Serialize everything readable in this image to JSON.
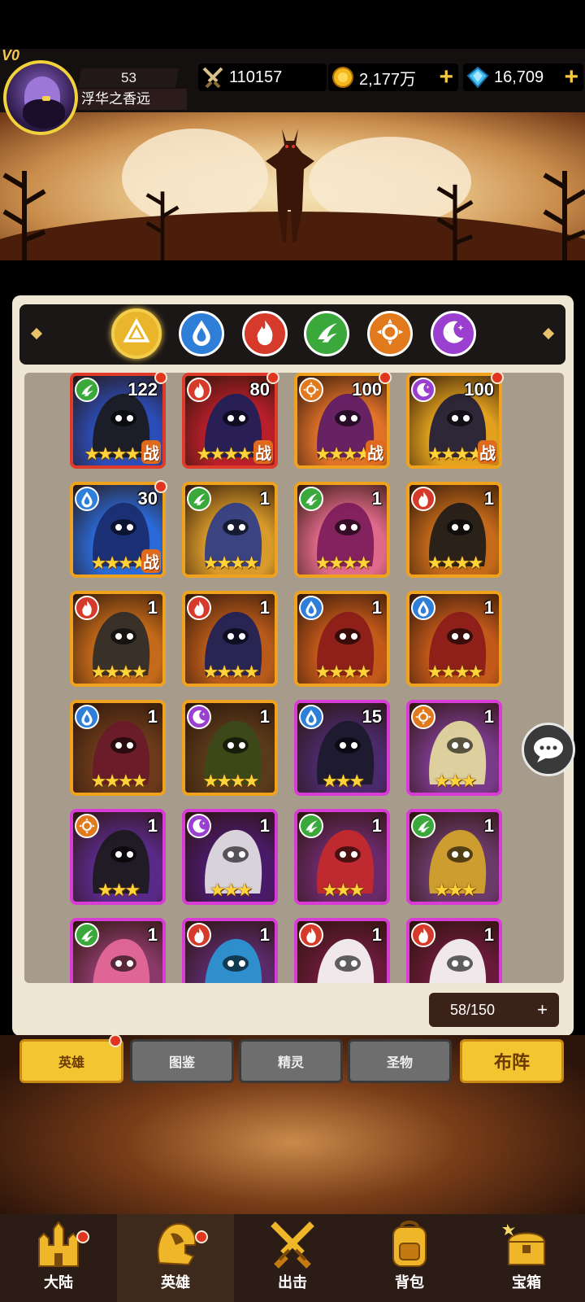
{
  "player": {
    "vip": "V0",
    "level": "53",
    "name": "浮华之香远"
  },
  "resources": {
    "power": "110157",
    "gold": "2,177万",
    "gems": "16,709",
    "plus": "+"
  },
  "elements": [
    {
      "name": "all",
      "color": "#e9b52a",
      "selected": true
    },
    {
      "name": "water",
      "color": "#2f7fd8",
      "selected": false
    },
    {
      "name": "fire",
      "color": "#d63a2a",
      "selected": false
    },
    {
      "name": "wind",
      "color": "#3aa83a",
      "selected": false
    },
    {
      "name": "light",
      "color": "#e07a1c",
      "selected": false
    },
    {
      "name": "dark",
      "color": "#9a3fd0",
      "selected": false
    }
  ],
  "heroes": [
    {
      "level": "122",
      "element": "wind",
      "stars": "★★★★★",
      "deployed": true,
      "badge": "战",
      "red_dot": true,
      "frame": "red"
    },
    {
      "level": "80",
      "element": "fire",
      "stars": "★★★★★",
      "deployed": true,
      "badge": "战",
      "red_dot": true,
      "frame": "red"
    },
    {
      "level": "100",
      "element": "light",
      "stars": "★★★★",
      "deployed": true,
      "badge": "战",
      "red_dot": true,
      "frame": "gold"
    },
    {
      "level": "100",
      "element": "dark",
      "stars": "★★★★",
      "deployed": true,
      "badge": "战",
      "red_dot": true,
      "frame": "gold"
    },
    {
      "level": "30",
      "element": "water",
      "stars": "★★★★",
      "deployed": true,
      "badge": "战",
      "red_dot": true,
      "frame": "gold"
    },
    {
      "level": "1",
      "element": "wind",
      "stars": "★★★★",
      "deployed": false,
      "badge": "",
      "red_dot": false,
      "frame": "gold"
    },
    {
      "level": "1",
      "element": "wind",
      "stars": "★★★★",
      "deployed": false,
      "badge": "",
      "red_dot": false,
      "frame": "gold"
    },
    {
      "level": "1",
      "element": "fire",
      "stars": "★★★★",
      "deployed": false,
      "badge": "",
      "red_dot": false,
      "frame": "gold"
    },
    {
      "level": "1",
      "element": "fire",
      "stars": "★★★★",
      "deployed": false,
      "badge": "",
      "red_dot": false,
      "frame": "gold"
    },
    {
      "level": "1",
      "element": "fire",
      "stars": "★★★★",
      "deployed": false,
      "badge": "",
      "red_dot": false,
      "frame": "gold"
    },
    {
      "level": "1",
      "element": "water",
      "stars": "★★★★",
      "deployed": false,
      "badge": "",
      "red_dot": false,
      "frame": "gold"
    },
    {
      "level": "1",
      "element": "water",
      "stars": "★★★★",
      "deployed": false,
      "badge": "",
      "red_dot": false,
      "frame": "gold"
    },
    {
      "level": "1",
      "element": "water",
      "stars": "★★★★",
      "deployed": false,
      "badge": "",
      "red_dot": false,
      "frame": "gold"
    },
    {
      "level": "1",
      "element": "dark",
      "stars": "★★★★",
      "deployed": false,
      "badge": "",
      "red_dot": false,
      "frame": "gold"
    },
    {
      "level": "15",
      "element": "water",
      "stars": "★★★",
      "deployed": false,
      "badge": "",
      "red_dot": false,
      "frame": "purple"
    },
    {
      "level": "1",
      "element": "light",
      "stars": "★★★",
      "deployed": false,
      "badge": "",
      "red_dot": false,
      "frame": "purple"
    },
    {
      "level": "1",
      "element": "light",
      "stars": "★★★",
      "deployed": false,
      "badge": "",
      "red_dot": false,
      "frame": "purple"
    },
    {
      "level": "1",
      "element": "dark",
      "stars": "★★★",
      "deployed": false,
      "badge": "",
      "red_dot": false,
      "frame": "purple"
    },
    {
      "level": "1",
      "element": "wind",
      "stars": "★★★",
      "deployed": false,
      "badge": "",
      "red_dot": false,
      "frame": "purple"
    },
    {
      "level": "1",
      "element": "wind",
      "stars": "★★★",
      "deployed": false,
      "badge": "",
      "red_dot": false,
      "frame": "purple"
    },
    {
      "level": "1",
      "element": "wind",
      "stars": "",
      "deployed": false,
      "badge": "",
      "red_dot": false,
      "frame": "purple"
    },
    {
      "level": "1",
      "element": "fire",
      "stars": "",
      "deployed": false,
      "badge": "",
      "red_dot": false,
      "frame": "purple"
    },
    {
      "level": "1",
      "element": "fire",
      "stars": "",
      "deployed": false,
      "badge": "",
      "red_dot": false,
      "frame": "purple"
    },
    {
      "level": "1",
      "element": "fire",
      "stars": "",
      "deployed": false,
      "badge": "",
      "red_dot": false,
      "frame": "purple"
    }
  ],
  "capacity": {
    "text": "58/150",
    "plus": "+"
  },
  "subtabs": [
    {
      "label": "英雄",
      "active": true,
      "red_dot": true
    },
    {
      "label": "图鉴",
      "active": false,
      "red_dot": false
    },
    {
      "label": "精灵",
      "active": false,
      "red_dot": false
    },
    {
      "label": "圣物",
      "active": false,
      "red_dot": false
    }
  ],
  "formation_button": "布阵",
  "nav": [
    {
      "label": "大陆",
      "icon": "castle-icon",
      "active": false,
      "red_dot": true
    },
    {
      "label": "英雄",
      "icon": "helmet-icon",
      "active": true,
      "red_dot": true
    },
    {
      "label": "出击",
      "icon": "crossed-swords-icon",
      "active": false,
      "red_dot": false
    },
    {
      "label": "背包",
      "icon": "backpack-icon",
      "active": false,
      "red_dot": false
    },
    {
      "label": "宝箱",
      "icon": "treasure-chest-icon",
      "active": false,
      "red_dot": false
    }
  ],
  "colors": {
    "accent_gold": "#f3c531",
    "badge_red": "#e2351f",
    "rare_purple": "#d83bd6",
    "epic_gold": "#f0a21e"
  }
}
